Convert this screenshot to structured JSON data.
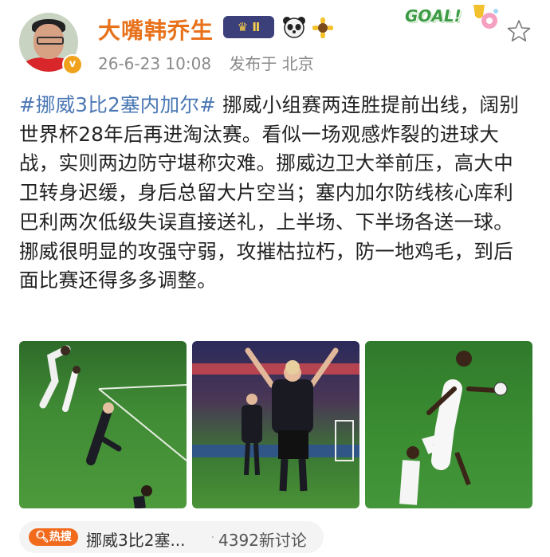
{
  "header": {
    "username": "大嘴韩乔生",
    "level_badge": "Ⅱ",
    "goal_sticker": "GOAL!",
    "timestamp": "26-6-23 10:08",
    "location": "发布于 北京",
    "verified_mark": "v"
  },
  "post": {
    "hashtag": "#挪威3比2塞内加尔#",
    "paragraph1": " 挪威小组赛两连胜提前出线，阔别世界杯28年后再进淘汰赛。看似一场观感炸裂的进球大战，实则两边防守堪称灾难。挪威边卫大举前压，高大中卫转身迟缓，身后总留大片空当；塞内加尔防线核心库利巴利两次低级失误直接送礼，上半场、下半场各送一球。",
    "paragraph2": "挪威很明显的攻强守弱，攻摧枯拉朽，防一地鸡毛，到后面比赛还得多多调整。"
  },
  "images": [
    {
      "icon": "soccer-action-photo"
    },
    {
      "icon": "player-celebration-photo"
    },
    {
      "icon": "soccer-action-photo"
    }
  ],
  "hot_topic": {
    "badge": "热搜",
    "title": "挪威3比2塞...",
    "separator": "·",
    "count": "4392新讨论"
  },
  "colors": {
    "username": "#e8721c",
    "hashtag": "#4a77b4",
    "hot_badge": "#f26b1d"
  }
}
